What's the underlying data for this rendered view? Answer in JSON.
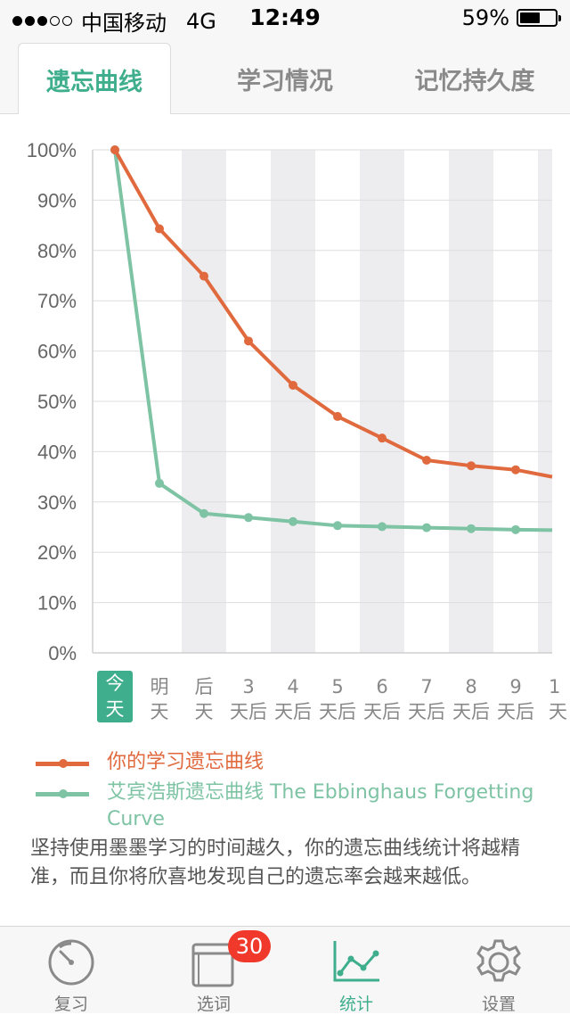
{
  "status_bar": {
    "carrier": "中国移动",
    "network": "4G",
    "time": "12:49",
    "battery": "59%",
    "battery_level": 0.59
  },
  "tabs": [
    {
      "label": "遗忘曲线",
      "active": true
    },
    {
      "label": "学习情况",
      "active": false
    },
    {
      "label": "记忆持久度",
      "active": false
    }
  ],
  "chart_data": {
    "type": "line",
    "y_ticks": [
      "100%",
      "90%",
      "80%",
      "70%",
      "60%",
      "50%",
      "40%",
      "30%",
      "20%",
      "10%",
      "0%"
    ],
    "ylim": [
      0,
      100
    ],
    "x_labels": [
      [
        "今",
        "天"
      ],
      [
        "明",
        "天"
      ],
      [
        "后",
        "天"
      ],
      [
        "3",
        "天后"
      ],
      [
        "4",
        "天后"
      ],
      [
        "5",
        "天后"
      ],
      [
        "6",
        "天后"
      ],
      [
        "7",
        "天后"
      ],
      [
        "8",
        "天后"
      ],
      [
        "9",
        "天后"
      ],
      [
        "1",
        "天"
      ]
    ],
    "series": [
      {
        "name": "你的学习遗忘曲线",
        "color": "#e06a3e",
        "values": [
          100,
          84.3,
          74.9,
          62,
          53.2,
          47,
          42.7,
          38.3,
          37.2,
          36.4,
          35
        ]
      },
      {
        "name": "艾宾浩斯遗忘曲线 The Ebbinghaus Forgetting Curve",
        "color": "#7dc3a4",
        "values": [
          100,
          33.7,
          27.7,
          26.9,
          26.1,
          25.3,
          25.1,
          24.9,
          24.7,
          24.5,
          24.4
        ]
      }
    ],
    "grid": true
  },
  "note": "坚持使用墨墨学习的时间越久，你的遗忘曲线统计将越精准，而且你将欣喜地发现自己的遗忘率会越来越低。",
  "bottom_nav": [
    {
      "label": "复习",
      "icon": "gauge-icon",
      "active": false
    },
    {
      "label": "选词",
      "icon": "book-icon",
      "badge": "30",
      "active": false
    },
    {
      "label": "统计",
      "icon": "line-chart-icon",
      "active": true
    },
    {
      "label": "设置",
      "icon": "gear-icon",
      "active": false
    }
  ],
  "colors": {
    "accent": "#3fae8c",
    "user_curve": "#e06a3e",
    "ebbinghaus_curve": "#7dc3a4",
    "badge": "#f0392b"
  }
}
